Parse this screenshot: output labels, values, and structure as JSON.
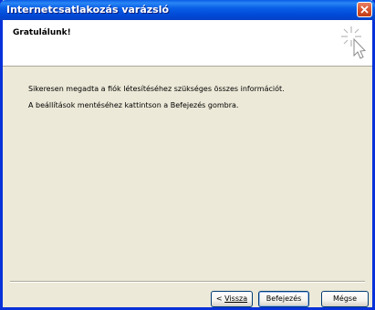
{
  "window": {
    "title": "Internetcsatlakozás varázsló"
  },
  "header": {
    "title": "Gratulálunk!",
    "icon": "wizard-sparkle-cursor-icon"
  },
  "content": {
    "line1": "Sikeresen megadta a fiók létesítéséhez szükséges összes információt.",
    "line2": "A beállítások mentéséhez kattintson a Befejezés gombra."
  },
  "buttons": {
    "back_prefix": "< ",
    "back_label": "Vissza",
    "finish_label": "Befejezés",
    "cancel_label": "Mégse"
  },
  "colors": {
    "titlebar": "#0a5ce5",
    "dialog_bg": "#ece9d8",
    "close_button": "#d9542e"
  }
}
